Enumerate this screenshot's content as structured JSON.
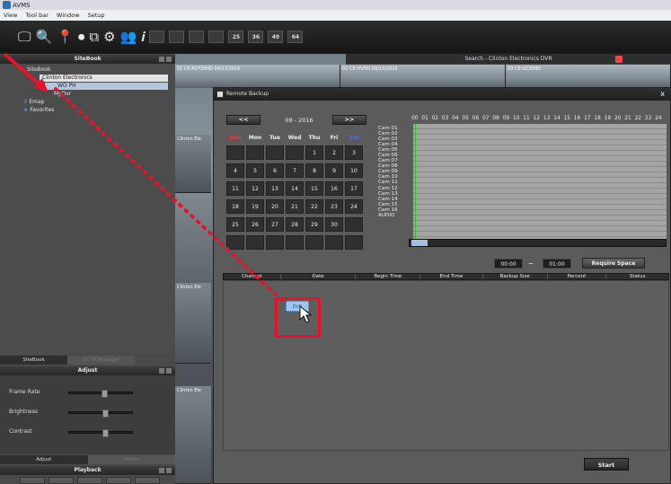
{
  "app": {
    "title": "AVMS"
  },
  "menu": [
    "View",
    "Tool bar",
    "Window",
    "Setup"
  ],
  "toolbar_grid_labels": [
    "25",
    "36",
    "49",
    "64"
  ],
  "search_bar": {
    "title": "Search - Clinton Electronics DVR"
  },
  "cam_strip": [
    "01 CE-PZT30HD",
    "02 CE-HVHD",
    "03 CE-VZ30HD",
    ""
  ],
  "cam_strip_timestamps": [
    "09/13/2016",
    "09/13/2016"
  ],
  "left_tiles": [
    "Clinton Ele",
    "Clinton Ele",
    "Clinton Ele"
  ],
  "sitebook": {
    "header": "SiteBook",
    "tree": {
      "root": "SiteBook",
      "site": "Clinton Electronics",
      "dvr": "MyDvr",
      "emap": "Emap",
      "favorites": "Favorites"
    },
    "tabs": [
      "SiteBook",
      "CCTV Manager"
    ]
  },
  "adjust": {
    "header": "Adjust",
    "rows": [
      {
        "label": "Frame Rate",
        "level": 0.55
      },
      {
        "label": "Brightness",
        "level": 0.57
      },
      {
        "label": "Contrast",
        "level": 0.57
      }
    ],
    "tabs": [
      "Adjust",
      "Status"
    ]
  },
  "playback": {
    "header": "Playback"
  },
  "dialog": {
    "title": "Remote Backup",
    "close": "x",
    "prev": "<<",
    "next": ">>",
    "month": "09 - 2016",
    "weekdays": [
      "Sun",
      "Mon",
      "Tue",
      "Wed",
      "Thu",
      "Fri",
      "Sat"
    ],
    "weekday_colors": [
      "#ff3333",
      "#eeeeee",
      "#eeeeee",
      "#eeeeee",
      "#eeeeee",
      "#eeeeee",
      "#4a6cff"
    ],
    "days": [
      "",
      "",
      "",
      "",
      "1",
      "2",
      "3",
      "4",
      "5",
      "6",
      "7",
      "8",
      "9",
      "10",
      "11",
      "12",
      "13",
      "14",
      "15",
      "16",
      "17",
      "18",
      "19",
      "20",
      "21",
      "22",
      "23",
      "24",
      "25",
      "26",
      "27",
      "28",
      "29",
      "30",
      "",
      "",
      "",
      "",
      "",
      "",
      "",
      ""
    ],
    "cameras": [
      "Cam 01",
      "Cam 02",
      "Cam 03",
      "Cam 04",
      "Cam 05",
      "Cam 06",
      "Cam 07",
      "Cam 08",
      "Cam 09",
      "Cam 10",
      "Cam 11",
      "Cam 12",
      "Cam 13",
      "Cam 14",
      "Cam 15",
      "Cam 16",
      "AUDIO"
    ],
    "hours": [
      "00",
      "01",
      "02",
      "03",
      "04",
      "05",
      "06",
      "07",
      "08",
      "09",
      "10",
      "11",
      "12",
      "13",
      "14",
      "15",
      "16",
      "17",
      "18",
      "19",
      "20",
      "21",
      "22",
      "23",
      "24"
    ],
    "time_from": "00:00",
    "tilde": "~",
    "time_to": "01:00",
    "require_space": "Require Space",
    "columns": [
      "Channel",
      "Date",
      "Begin Time",
      "End Time",
      "Backup Size",
      "Percent",
      "Status"
    ],
    "start": "Start"
  },
  "drag_item": "DVR"
}
